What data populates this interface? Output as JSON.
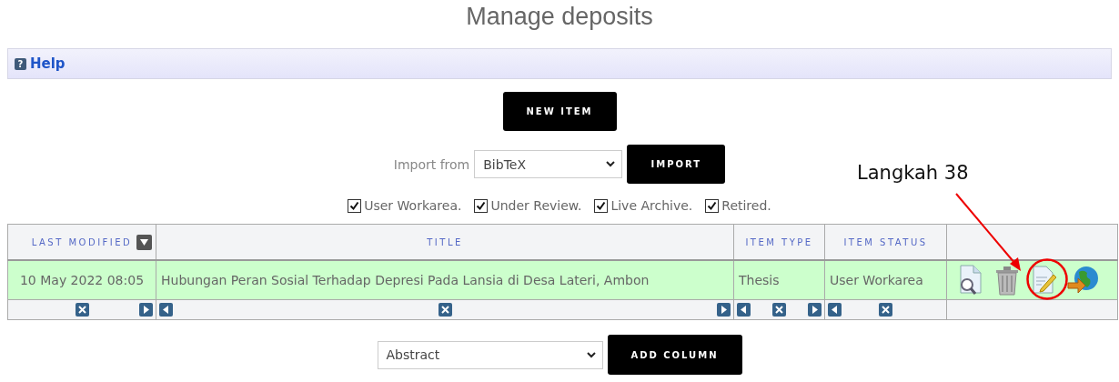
{
  "page_title": "Manage deposits",
  "help": {
    "icon": "?",
    "label": "Help"
  },
  "new_item_button": "NEW ITEM",
  "import": {
    "label": "Import from",
    "value": "BibTeX",
    "button": "IMPORT"
  },
  "filters": [
    {
      "label": "User Workarea.",
      "checked": true
    },
    {
      "label": "Under Review.",
      "checked": true
    },
    {
      "label": "Live Archive.",
      "checked": true
    },
    {
      "label": "Retired.",
      "checked": true
    }
  ],
  "table": {
    "columns": [
      {
        "label": "LAST MODIFIED",
        "sorted": true,
        "removable": true,
        "move_left": false,
        "move_right": true
      },
      {
        "label": "TITLE",
        "sorted": false,
        "removable": true,
        "move_left": true,
        "move_right": true
      },
      {
        "label": "ITEM TYPE",
        "sorted": false,
        "removable": true,
        "move_left": true,
        "move_right": true
      },
      {
        "label": "ITEM STATUS",
        "sorted": false,
        "removable": true,
        "move_left": true,
        "move_right": false
      }
    ],
    "rows": [
      {
        "cells": [
          "10 May 2022 08:05",
          "Hubungan Peran Sosial Terhadap Depresi Pada Lansia di Desa Lateri, Ambon",
          "Thesis",
          "User Workarea"
        ],
        "actions": [
          {
            "kind": "view"
          },
          {
            "kind": "delete"
          },
          {
            "kind": "edit",
            "highlighted": true
          },
          {
            "kind": "deposit"
          }
        ]
      }
    ]
  },
  "add_column": {
    "value": "Abstract",
    "button": "ADD COLUMN"
  },
  "annotation": {
    "label": "Langkah 38"
  }
}
